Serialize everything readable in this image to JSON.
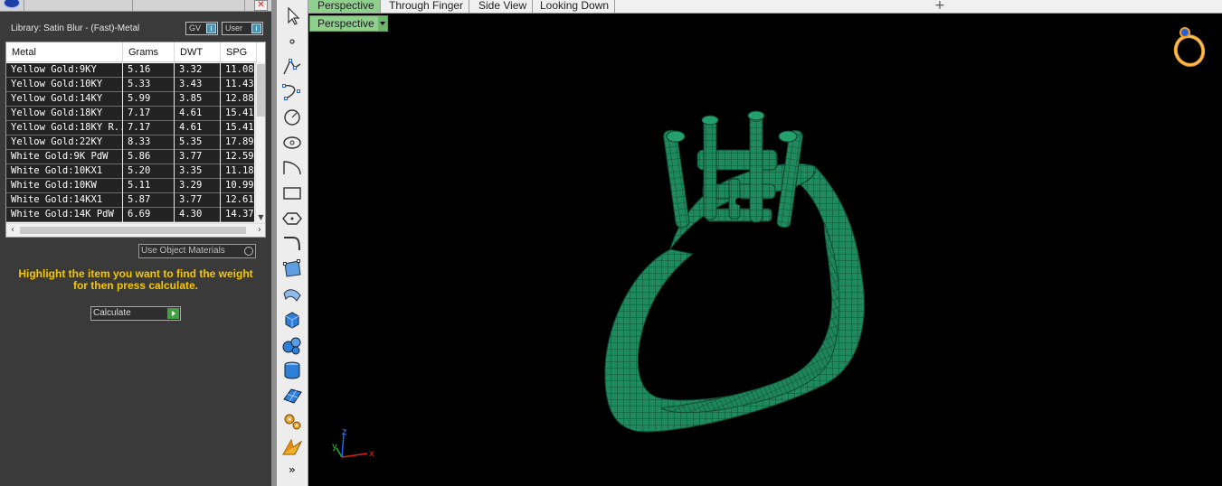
{
  "panel": {
    "library_label": "Library: Satin Blur - (Fast)-Metal",
    "toggles": {
      "gv": "GV",
      "user": "User"
    },
    "table": {
      "headers": [
        "Metal",
        "Grams",
        "DWT",
        "SPG"
      ],
      "rows": [
        [
          "Yellow Gold:9KY",
          "5.16",
          "3.32",
          "11.08"
        ],
        [
          "Yellow Gold:10KY",
          "5.33",
          "3.43",
          "11.43"
        ],
        [
          "Yellow Gold:14KY",
          "5.99",
          "3.85",
          "12.88"
        ],
        [
          "Yellow Gold:18KY",
          "7.17",
          "4.61",
          "15.41"
        ],
        [
          "Yellow Gold:18KY R...",
          "7.17",
          "4.61",
          "15.41"
        ],
        [
          "Yellow Gold:22KY",
          "8.33",
          "5.35",
          "17.89"
        ],
        [
          "White Gold:9K PdW",
          "5.86",
          "3.77",
          "12.59"
        ],
        [
          "White Gold:10KX1",
          "5.20",
          "3.35",
          "11.18"
        ],
        [
          "White Gold:10KW",
          "5.11",
          "3.29",
          "10.99"
        ],
        [
          "White Gold:14KX1",
          "5.87",
          "3.77",
          "12.61"
        ],
        [
          "White Gold:14K PdW",
          "6.69",
          "4.30",
          "14.37"
        ]
      ]
    },
    "use_object_materials": "Use Object Materials",
    "instruction_line1": "Highlight the item you want to find the weight",
    "instruction_line2": "for then press calculate.",
    "calculate_label": "Calculate"
  },
  "viewport": {
    "tabs": [
      "Perspective",
      "Through Finger",
      "Side View",
      "Looking Down"
    ],
    "active_tab": "Perspective",
    "view_dropdown": "Perspective",
    "axis_labels": {
      "x": "x",
      "y": "y",
      "z": "z"
    }
  },
  "toolbar": {
    "tools": [
      "select-arrow-icon",
      "point-icon",
      "polyline-icon",
      "curve-points-icon",
      "circle-icon",
      "ellipse-icon",
      "arc-icon",
      "rectangle-icon",
      "polygon-icon",
      "fillet-curve-icon",
      "surface-edit-icon",
      "sweep-icon",
      "box-solid-icon",
      "spheres-icon",
      "cylinder-icon",
      "surface-mesh-icon",
      "gears-icon",
      "render-icon"
    ],
    "more": "»"
  },
  "colors": {
    "model_green": "#1f8a5e",
    "wire_green": "#0c3f2a",
    "highlight_yellow": "#f6c700",
    "tab_active": "#8fd08f"
  }
}
